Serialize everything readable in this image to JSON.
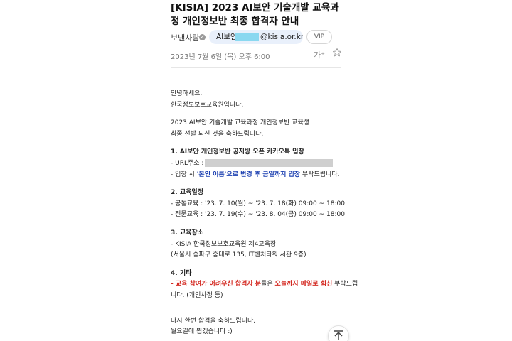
{
  "mail": {
    "subject": "[KISIA] 2023 AI보안 기술개발 교육과정 개인정보반 최종 합격자 안내",
    "sender_label": "보낸사람",
    "sender_badge_icon": "check-badge-icon",
    "sender_name": "AI보안",
    "sender_domain": "@kisia.or.kr>",
    "vip_label": "VIP",
    "date": "2023년 7월 6일 (목) 오후 6:00",
    "font_size_icon_label": "가⁺"
  },
  "body": {
    "greeting": "안녕하세요.",
    "org": "한국정보보호교육원입니다.",
    "intro1": "2023 AI보안 기술개발 교육과정 개인정보반 교육생",
    "intro2": "최종 선발 되신 것을 축하드립니다.",
    "s1_title": "1. AI보안 개인정보반 공지방 오픈 카카오톡 입장",
    "s1_url_label": "- URL주소 :",
    "s1_note_prefix": "- 입장 시 ",
    "s1_note_highlight": "'본인 이름'으로 변경 후 금일까지 입장",
    "s1_note_suffix": " 부탁드립니다.",
    "s2_title": "2. 교육일정",
    "s2_common": "- 공통교육 : '23. 7. 10(월) ~ '23. 7. 18(화) 09:00 ~ 18:00",
    "s2_special": "- 전문교육 : '23. 7. 19(수) ~ '23. 8. 04(금) 09:00 ~ 18:00",
    "s3_title": "3. 교육장소",
    "s3_place": "- KISIA 한국정보보호교육원 제4교육장",
    "s3_address": "(서울시 송파구 중대로 135, IT벤처타워 서관 9층)",
    "s4_title": "4. 기타",
    "s4_red1": "- 교육 참여가 어려우신 합격자 분",
    "s4_mid": "들은 ",
    "s4_red2": "오늘까지 메일로 회신",
    "s4_tail": " 부탁드립",
    "s4_line2": "니다. (개인사정 등)",
    "closing1": "다시 한번 합격을 축하드립니다.",
    "closing2": "월요일에 뵙겠습니다 :)"
  },
  "colors": {
    "highlight_blue": "#1a3eb0",
    "highlight_red": "#d42a22",
    "chip_bg": "#e9f0fb"
  },
  "icons": {
    "star": "star-icon",
    "scroll_top": "scroll-to-top-icon"
  }
}
